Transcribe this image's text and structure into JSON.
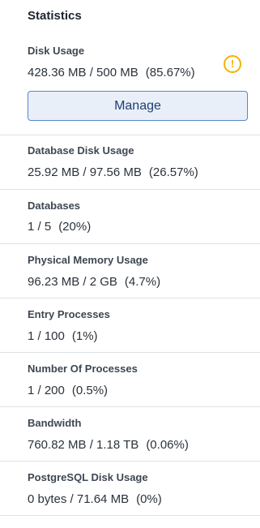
{
  "panel": {
    "title": "Statistics",
    "manage_label": "Manage",
    "warning_icon": "exclamation-circle-icon",
    "accent_warning": "#f2b300"
  },
  "stats": [
    {
      "label": "Disk Usage",
      "amount": "428.36 MB / 500 MB",
      "percent": "(85.67%)"
    },
    {
      "label": "Database Disk Usage",
      "amount": "25.92 MB / 97.56 MB",
      "percent": "(26.57%)"
    },
    {
      "label": "Databases",
      "amount": "1 / 5",
      "percent": "(20%)"
    },
    {
      "label": "Physical Memory Usage",
      "amount": "96.23 MB / 2 GB",
      "percent": "(4.7%)"
    },
    {
      "label": "Entry Processes",
      "amount": "1 / 100",
      "percent": "(1%)"
    },
    {
      "label": "Number Of Processes",
      "amount": "1 / 200",
      "percent": "(0.5%)"
    },
    {
      "label": "Bandwidth",
      "amount": "760.82 MB / 1.18 TB",
      "percent": "(0.06%)"
    },
    {
      "label": "PostgreSQL Disk Usage",
      "amount": "0 bytes / 71.64 MB",
      "percent": "(0%)"
    }
  ]
}
